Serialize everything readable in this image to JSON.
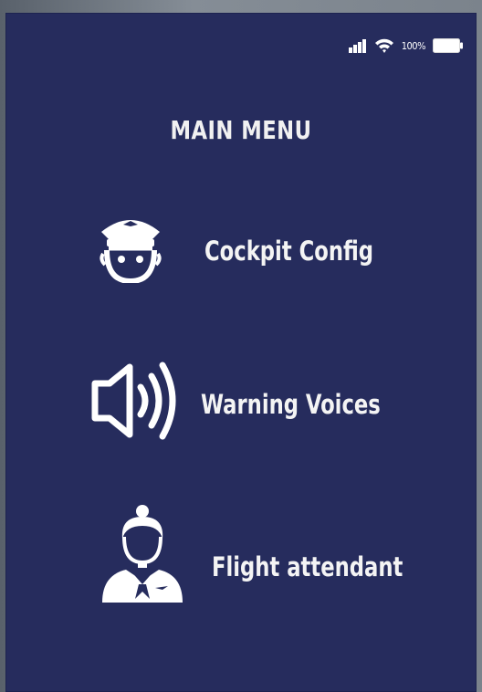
{
  "status_bar": {
    "battery_percent": "100%",
    "icons": [
      "signal-icon",
      "wifi-icon",
      "battery-icon"
    ]
  },
  "menu": {
    "title": "MAIN MENU",
    "items": [
      {
        "label": "Cockpit Config",
        "icon": "pilot-icon"
      },
      {
        "label": "Warning Voices",
        "icon": "speaker-icon"
      },
      {
        "label": "Flight attendant",
        "icon": "flight-attendant-icon"
      }
    ]
  },
  "colors": {
    "screen_background": "#262c5d",
    "text": "#f4f4f4",
    "device_frame": "#6e767f"
  }
}
